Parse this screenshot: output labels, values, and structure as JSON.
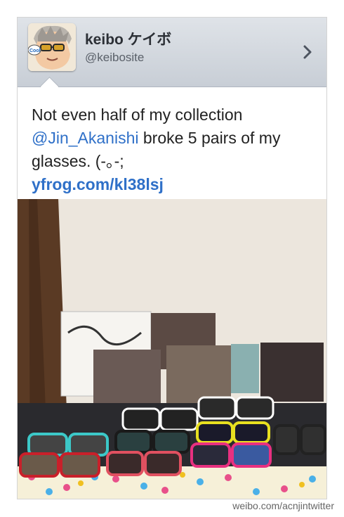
{
  "user": {
    "display_name": "keibo ケイボ",
    "handle": "@keibosite",
    "avatar_text": "Cool"
  },
  "tweet": {
    "text_before": "Not even half of my collection",
    "mention": "@Jin_Akanishi",
    "text_after": " broke 5 pairs of my glasses. (-｡-;",
    "link": "yfrog.com/kl38lsj"
  },
  "photo": {
    "description_icons": [
      "sunglasses-collection"
    ]
  },
  "watermark": "weibo.com/acnjintwitter",
  "colors": {
    "header_top": "#dfe3e8",
    "header_bottom": "#c8ced6",
    "link": "#2f70c8",
    "text": "#222222"
  }
}
